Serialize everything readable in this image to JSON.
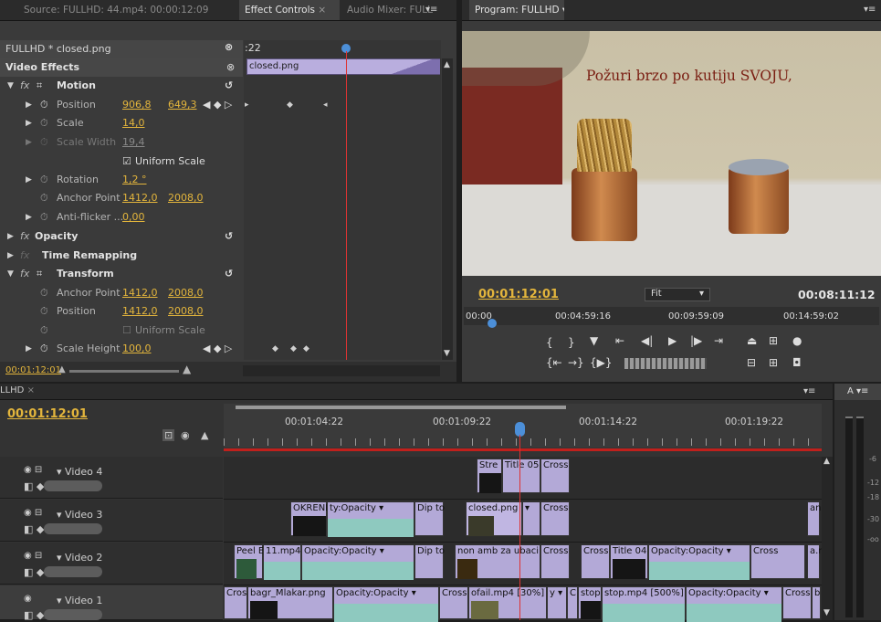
{
  "source_tab": "Source: FULLHD: 44.mp4: 00:00:12:09",
  "effect_tab": "Effect Controls",
  "audio_tab": "Audio Mixer: FULL",
  "program_tab": "Program: FULLHD",
  "sequence_name": "FULLHD * closed.png",
  "clip_name": "closed.png",
  "ec_time_short": ":22",
  "sections": {
    "video_effects": "Video Effects",
    "motion": "Motion",
    "opacity": "Opacity",
    "time_remap": "Time Remapping",
    "transform": "Transform"
  },
  "motion": [
    {
      "label": "Position",
      "v1": "906,8",
      "v2": "649,3"
    },
    {
      "label": "Scale",
      "v1": "14,0"
    },
    {
      "label": "Scale Width",
      "v1": "19,4"
    },
    {
      "label": "Uniform Scale"
    },
    {
      "label": "Rotation",
      "v1": "1,2 °"
    },
    {
      "label": "Anchor Point",
      "v1": "1412,0",
      "v2": "2008,0"
    },
    {
      "label": "Anti-flicker ...",
      "v1": "0,00"
    }
  ],
  "transform": [
    {
      "label": "Anchor Point",
      "v1": "1412,0",
      "v2": "2008,0"
    },
    {
      "label": "Position",
      "v1": "1412,0",
      "v2": "2008,0"
    },
    {
      "label": "Uniform Scale"
    },
    {
      "label": "Scale Height",
      "v1": "100,0"
    }
  ],
  "ec_footer_time": "00:01:12:01",
  "program": {
    "overlay_text": "Požuri brzo po kutiju SVOJU,",
    "current_time": "00:01:12:01",
    "fit": "Fit",
    "duration": "00:08:11:12",
    "ruler": [
      "00:00",
      "00:04:59:16",
      "00:09:59:09",
      "00:14:59:02"
    ]
  },
  "timeline": {
    "tab": "LLHD",
    "current_time": "00:01:12:01",
    "ruler": [
      "00:01:04:22",
      "00:01:09:22",
      "00:01:14:22",
      "00:01:19:22"
    ],
    "tracks": [
      "Video 4",
      "Video 3",
      "Video 2",
      "Video 1"
    ],
    "v4": [
      "Stre",
      "Title 05",
      "Cross"
    ],
    "v3": [
      "OKRENI NA",
      "ty:Opacity ▾",
      "Dip to",
      "closed.png",
      "▾",
      "Cross",
      "an"
    ],
    "v2": [
      "Peel E",
      "11.mp4",
      "Opacity:Opacity ▾",
      "Dip to",
      "non amb za ubaci",
      "Cross",
      "Cross",
      "Title 04",
      "Opacity:Opacity ▾",
      "Cross",
      "a.r"
    ],
    "v1": [
      "Cross",
      "bagr_Mlakar.png",
      "Opacity:Opacity ▾",
      "Cross",
      "ofail.mp4 [30%]",
      "y ▾",
      "C",
      "stop",
      "stop.mp4 [500%]",
      "Opacity:Opacity ▾",
      "Cross",
      "b"
    ]
  },
  "audio_meter": {
    "tab": "A",
    "ticks": [
      "-6",
      "-12",
      "-18",
      "-30",
      "-oo"
    ]
  }
}
